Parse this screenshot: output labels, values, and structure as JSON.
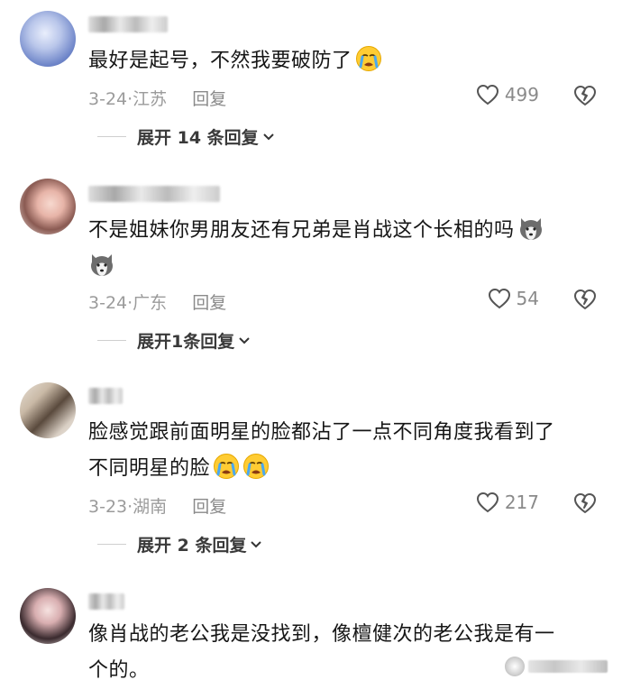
{
  "comments": [
    {
      "text": "最好是起号，不然我要破防了",
      "emojis": [
        "crying-face-icon"
      ],
      "date": "3-24",
      "location": "江苏",
      "reply_label": "回复",
      "likes": "499",
      "expand_label": "展开 14 条回复"
    },
    {
      "text_line1": "不是姐妹你男朋友还有兄弟是肖战这个长相的吗",
      "emojis": [
        "husky-face-icon",
        "husky-face-icon"
      ],
      "date": "3-24",
      "location": "广东",
      "reply_label": "回复",
      "likes": "54",
      "expand_label": "展开1条回复"
    },
    {
      "text_line1": "脸感觉跟前面明星的脸都沾了一点不同角度我看到了",
      "text_line2": "不同明星的脸",
      "emojis": [
        "crying-face-icon",
        "crying-face-icon"
      ],
      "date": "3-23",
      "location": "湖南",
      "reply_label": "回复",
      "likes": "217",
      "expand_label": "展开 2 条回复"
    },
    {
      "text_line1": "像肖战的老公我是没找到，像檀健次的老公我是有一",
      "text_line2": "个的。"
    }
  ],
  "date_separator": "·",
  "colors": {
    "text": "#161616",
    "meta": "#9b9b9b",
    "background": "#ffffff"
  }
}
